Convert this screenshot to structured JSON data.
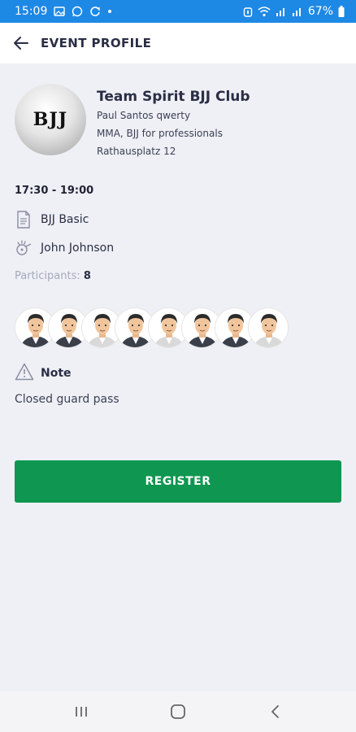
{
  "status_bar": {
    "time": "15:09",
    "battery": "67%"
  },
  "app_bar": {
    "title": "EVENT PROFILE"
  },
  "club": {
    "logo_text": "BJJ",
    "name": "Team Spirit BJJ Club",
    "owner": "Paul Santos qwerty",
    "description": "MMA, BJJ for professionals",
    "address": "Rathausplatz 12"
  },
  "event": {
    "time": "17:30 - 19:00",
    "class_name": "BJJ Basic",
    "coach": "John Johnson",
    "participants_label": "Participants:",
    "participants_count": "8",
    "participant_count_avatars": 8
  },
  "note": {
    "label": "Note",
    "text": "Closed guard pass"
  },
  "register_button": {
    "label": "REGISTER"
  },
  "colors": {
    "status_bar": "#1e88e5",
    "register": "#0f9650",
    "background": "#eef0f5"
  },
  "icons": [
    "back-arrow-icon",
    "document-icon",
    "coach-icon",
    "warning-icon"
  ]
}
